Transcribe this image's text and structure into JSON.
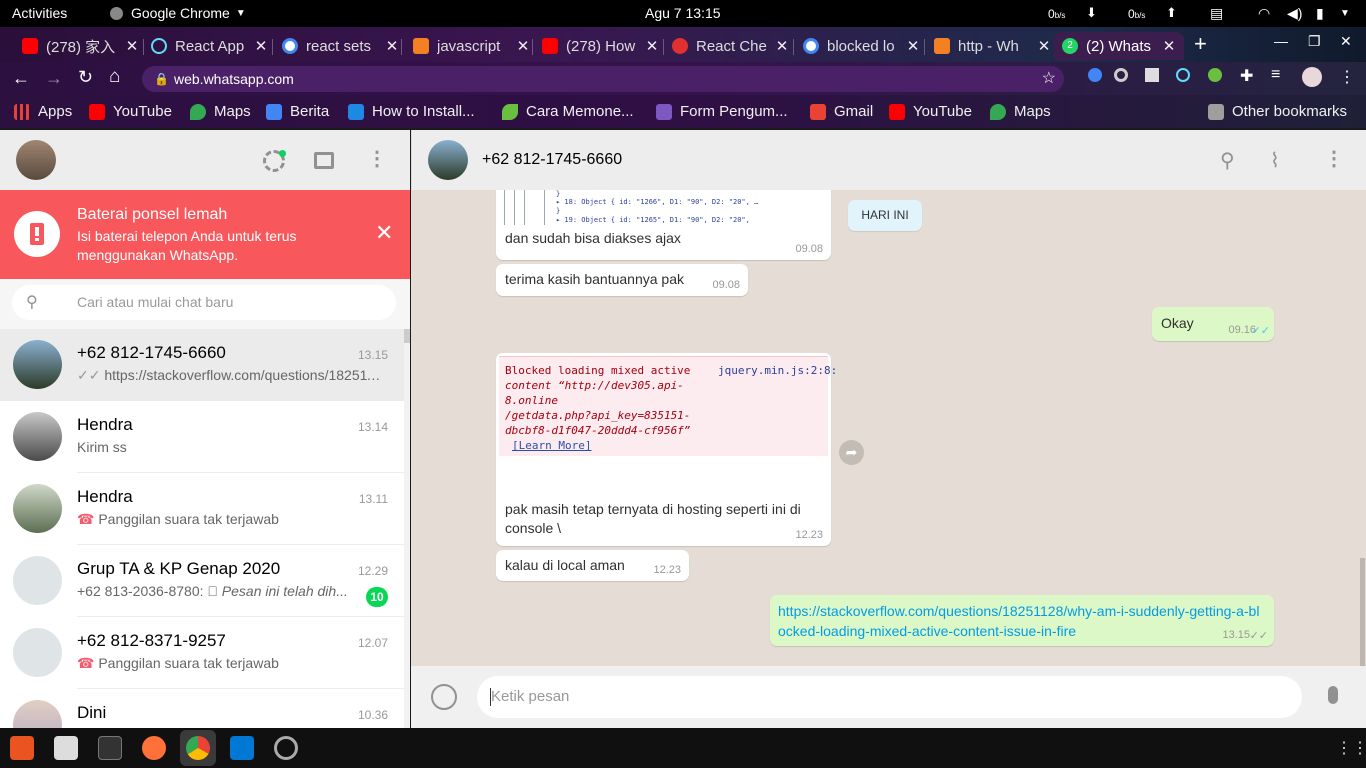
{
  "system": {
    "activities": "Activities",
    "app_name": "Google Chrome",
    "datetime": "Agu 7  13:15",
    "net_down": "0",
    "net_down_unit": "b/s",
    "net_up": "0",
    "net_up_unit": "b/s"
  },
  "browser": {
    "tabs": [
      {
        "label": "(278) 家入",
        "favicon_color": "#ff0000"
      },
      {
        "label": "React App",
        "favicon_color": "#61dafb"
      },
      {
        "label": "react sets",
        "favicon_color": "#4285f4"
      },
      {
        "label": "javascript",
        "favicon_color": "#f48024"
      },
      {
        "label": "(278) How",
        "favicon_color": "#ff0000"
      },
      {
        "label": "React Che",
        "favicon_color": "#e03030"
      },
      {
        "label": "blocked lo",
        "favicon_color": "#4285f4"
      },
      {
        "label": "http - Wh",
        "favicon_color": "#f48024"
      },
      {
        "label": "(2) Whats",
        "favicon_color": "#25d366",
        "badge": "2"
      }
    ],
    "new_tab_label": "+",
    "url": "web.whatsapp.com",
    "bookmarks": [
      {
        "label": "Apps",
        "icon": "apps-grid-icon",
        "color": "#e94235"
      },
      {
        "label": "YouTube",
        "icon": "youtube-icon",
        "color": "#ff0000"
      },
      {
        "label": "Maps",
        "icon": "maps-icon",
        "color": "#34a853"
      },
      {
        "label": "Berita",
        "icon": "news-icon",
        "color": "#4285f4"
      },
      {
        "label": "How to Install...",
        "icon": "cloud-icon",
        "color": "#1e88e5"
      },
      {
        "label": "Cara Memone...",
        "icon": "leaf-icon",
        "color": "#6abf40"
      },
      {
        "label": "Form Pengum...",
        "icon": "form-icon",
        "color": "#7e57c2"
      },
      {
        "label": "Gmail",
        "icon": "gmail-icon",
        "color": "#ea4335"
      },
      {
        "label": "YouTube",
        "icon": "youtube-icon",
        "color": "#ff0000"
      },
      {
        "label": "Maps",
        "icon": "maps-icon",
        "color": "#34a853"
      }
    ],
    "other_bookmarks": "Other bookmarks"
  },
  "whatsapp": {
    "banner": {
      "title": "Baterai ponsel lemah",
      "line1": "Isi baterai telepon Anda untuk terus",
      "line2": "menggunakan WhatsApp."
    },
    "search_placeholder": "Cari atau mulai chat baru",
    "chats": [
      {
        "name": "+62 812-1745-6660",
        "time": "13.15",
        "preview": "https://stackoverflow.com/questions/182511...",
        "status": "read-ticks",
        "selected": true,
        "avatar_color": "#3d5a7a"
      },
      {
        "name": "Hendra",
        "time": "13.14",
        "preview": "Kirim ss",
        "avatar_color": "#6d6d6d"
      },
      {
        "name": "Hendra",
        "time": "13.11",
        "preview": "Panggilan suara tak terjawab",
        "status": "missed-call",
        "avatar_color": "#5c6f52"
      },
      {
        "name": "Grup TA & KP Genap 2020",
        "time": "12.29",
        "preview_sender": "+62 813-2036-8780: ",
        "preview": "Pesan ini telah dih...",
        "status": "deleted",
        "unread": "10",
        "avatar_color": "#dfe5e7"
      },
      {
        "name": "+62 812-8371-9257",
        "time": "12.07",
        "preview": "Panggilan suara tak terjawab",
        "status": "missed-call",
        "avatar_color": "#dfe5e7"
      },
      {
        "name": "Dini",
        "time": "10.36",
        "preview": "",
        "avatar_color": "#b8a8c8"
      }
    ],
    "active_chat": {
      "title": "+62 812-1745-6660",
      "date_chip": "HARI INI",
      "messages": [
        {
          "text": "dan sudah bisa diakses ajax",
          "time": "09.08",
          "dir": "in"
        },
        {
          "text": "terima kasih bantuannya pak",
          "time": "09.08",
          "dir": "in"
        },
        {
          "text": "Okay",
          "time": "09.16",
          "dir": "out"
        },
        {
          "text": "pak masih tetap ternyata di hosting seperti ini di console \\",
          "time": "12.23",
          "dir": "in"
        },
        {
          "text": "kalau di local aman",
          "time": "12.23",
          "dir": "in"
        },
        {
          "text": "https://stackoverflow.com/questions/18251128/why-am-i-suddenly-getting-a-blocked-loading-mixed-active-content-issue-in-fire",
          "time": "13.15",
          "dir": "out"
        }
      ],
      "console_lines": [
        "▸ 18: Object { id: \"1266\", D1: \"90\", D2: \"20\", …",
        "▸ 19: Object { id: \"1265\", D1: \"90\", D2: \"20\","
      ],
      "console_error": {
        "line1": "Blocked loading mixed active",
        "line2": "content “http://dev305.api-",
        "line3": "8.online",
        "line4": "/getdata.php?api_key=835151-",
        "line5": "dbcbf8-d1f047-20ddd4-cf956f”",
        "learn_more": "[Learn More]",
        "source": "jquery.min.js:2:8:"
      },
      "composer_placeholder": "Ketik pesan"
    }
  }
}
